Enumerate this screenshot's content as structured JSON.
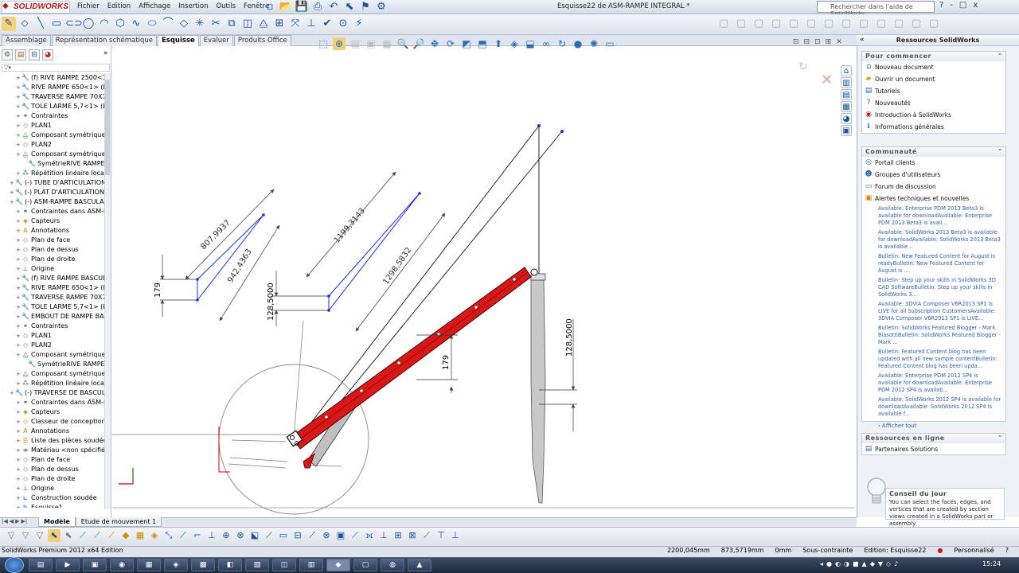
{
  "app": {
    "logo_text": "SOLIDWORKS",
    "window_title": "Esquisse22 de ASM-RAMPE INTEGRAL *",
    "menu": [
      "Fichier",
      "Edition",
      "Affichage",
      "Insertion",
      "Outils",
      "Fenêtre"
    ],
    "help_search_placeholder": "Rechercher dans l'aide de SolidWorks",
    "window_controls": [
      "?",
      "-",
      "□",
      "x"
    ]
  },
  "command_tabs": [
    "Assemblage",
    "Représentation schématique",
    "Esquisse",
    "Evaluer",
    "Produits Office"
  ],
  "active_command_tab": "Esquisse",
  "feature_tree": [
    {
      "label": "(f) RIVE RAMPE 2500<1> (",
      "indent": 2,
      "icon": "part"
    },
    {
      "label": "RIVE RAMPE 650<1> (Déf",
      "indent": 2,
      "icon": "part"
    },
    {
      "label": "TRAVERSE RAMPE 70X70",
      "indent": 2,
      "icon": "part"
    },
    {
      "label": "TOLE LARME 5,7<1> (Déf",
      "indent": 2,
      "icon": "part"
    },
    {
      "label": "Contraintes",
      "indent": 2,
      "icon": "mates"
    },
    {
      "label": "PLAN1",
      "indent": 2,
      "icon": "plane"
    },
    {
      "label": "Composant symétrique1",
      "indent": 2,
      "icon": "mirror"
    },
    {
      "label": "PLAN2",
      "indent": 2,
      "icon": "plane"
    },
    {
      "label": "Composant symétrique2",
      "indent": 2,
      "icon": "mirror"
    },
    {
      "label": "SymétrieRIVE RAMPE",
      "indent": 3,
      "icon": "part"
    },
    {
      "label": "Répétition linéaire locale1",
      "indent": 2,
      "icon": "pattern"
    },
    {
      "label": "(-) TUBE D'ARTICULATION D",
      "indent": 1,
      "icon": "part"
    },
    {
      "label": "(-) PLAT D'ARTICULATION T",
      "indent": 1,
      "icon": "part"
    },
    {
      "label": "(-) ASM-RAMPE BASCULANT",
      "indent": 1,
      "icon": "asm"
    },
    {
      "label": "Contraintes dans ASM-RA",
      "indent": 2,
      "icon": "mates"
    },
    {
      "label": "Capteurs",
      "indent": 2,
      "icon": "sensor"
    },
    {
      "label": "Annotations",
      "indent": 2,
      "icon": "annot"
    },
    {
      "label": "Plan de face",
      "indent": 2,
      "icon": "plane"
    },
    {
      "label": "Plan de dessus",
      "indent": 2,
      "icon": "plane"
    },
    {
      "label": "Plan de droite",
      "indent": 2,
      "icon": "plane"
    },
    {
      "label": "Origine",
      "indent": 2,
      "icon": "origin"
    },
    {
      "label": "(f) RIVE RAMPE BASCULA",
      "indent": 2,
      "icon": "part"
    },
    {
      "label": "RIVE RAMPE 650<1> (Déf",
      "indent": 2,
      "icon": "part"
    },
    {
      "label": "TRAVERSE RAMPE 70X70",
      "indent": 2,
      "icon": "part"
    },
    {
      "label": "TOLE LARME 5,7<1> (Déf",
      "indent": 2,
      "icon": "part"
    },
    {
      "label": "EMBOUT DE RAMPE BASC",
      "indent": 2,
      "icon": "part"
    },
    {
      "label": "Contraintes",
      "indent": 2,
      "icon": "mates"
    },
    {
      "label": "PLAN1",
      "indent": 2,
      "icon": "plane"
    },
    {
      "label": "PLAN2",
      "indent": 2,
      "icon": "plane"
    },
    {
      "label": "Composant symétrique1",
      "indent": 2,
      "icon": "mirror"
    },
    {
      "label": "SymétrieRIVE RAMPE",
      "indent": 3,
      "icon": "part"
    },
    {
      "label": "Composant symétrique2",
      "indent": 2,
      "icon": "mirror"
    },
    {
      "label": "Répétition linéaire locale1",
      "indent": 2,
      "icon": "pattern"
    },
    {
      "label": "(-) TRAVERSE DE BASCULEM",
      "indent": 1,
      "icon": "part"
    },
    {
      "label": "Contraintes dans ASM-RA",
      "indent": 2,
      "icon": "mates"
    },
    {
      "label": "Capteurs",
      "indent": 2,
      "icon": "sensor"
    },
    {
      "label": "Classeur de conception",
      "indent": 2,
      "icon": "folder"
    },
    {
      "label": "Annotations",
      "indent": 2,
      "icon": "annot"
    },
    {
      "label": "Liste des pièces soudées(1",
      "indent": 2,
      "icon": "list"
    },
    {
      "label": "Matériau <non spécifié>",
      "indent": 2,
      "icon": "material"
    },
    {
      "label": "Plan de face",
      "indent": 2,
      "icon": "plane"
    },
    {
      "label": "Plan de dessus",
      "indent": 2,
      "icon": "plane"
    },
    {
      "label": "Plan de droite",
      "indent": 2,
      "icon": "plane"
    },
    {
      "label": "Origine",
      "indent": 2,
      "icon": "origin"
    },
    {
      "label": "Construction soudée",
      "indent": 2,
      "icon": "weld"
    },
    {
      "label": "Esquisse1",
      "indent": 2,
      "icon": "sketch"
    }
  ],
  "dimensions": {
    "d1": "807,9937",
    "d2": "942,4363",
    "d3": "1199,3143",
    "d4": "1298,5832",
    "d5": "179",
    "d6": "128,5000",
    "d7": "179",
    "d8": "128,5000"
  },
  "colors": {
    "ramp": "#d81818",
    "sketch_blue": "#1a2fd8",
    "dim_grey": "#555555",
    "selected_line": "#0000ff"
  },
  "taskpane": {
    "title": "Ressources SolidWorks",
    "sections": [
      {
        "title": "Pour commencer",
        "links": [
          {
            "label": "Nouveau document",
            "icon": "new-doc-icon"
          },
          {
            "label": "Ouvrir un document",
            "icon": "open-folder-icon"
          },
          {
            "label": "Tutoriels",
            "icon": "tutorial-icon"
          },
          {
            "label": "Nouveautés",
            "icon": "whats-new-icon"
          },
          {
            "label": "Introduction à SolidWorks",
            "icon": "intro-icon"
          },
          {
            "label": "Informations générales",
            "icon": "info-icon"
          }
        ]
      },
      {
        "title": "Communauté",
        "links": [
          {
            "label": "Portail clients",
            "icon": "portal-icon"
          },
          {
            "label": "Groupes d'utilisateurs",
            "icon": "users-icon"
          },
          {
            "label": "Forum de discussion",
            "icon": "forum-icon"
          },
          {
            "label": "Alertes techniques et nouvelles",
            "icon": "rss-icon"
          }
        ],
        "news": [
          "Available: Enterprise PDM 2013 Beta3 is available for downloadAvailable: Enterprise PDM 2013 Beta3 is avail...",
          "Available: SolidWorks 2013 Beta3 is available for downloadAvailable: SolidWorks 2013 Beta3 is available...",
          "Bulletin: New Featured Content for August is readyBulletin: New Featured Content for August is ...",
          "Bulletin: Step up your skills in SolidWorks 3D CAD SoftwareBulletin: Step up your skills in SolidWorks 3...",
          "Available: 3DVIA Composer V6R2013 SP1 is LIVE for all Subscription CustomersAvailable: 3DVIA Composer V6R2013 SP1 is LIVE...",
          "Bulletin: SolidWorks Featured Blogger - Mark BiasottiBulletin: SolidWorks Featured Blogger - Mark ...",
          "Bulletin: Featured Content blog has been updated with all new sample contentBulletin: Featured Content blog has been upda...",
          "Available: Enterprise PDM 2012 SP4 is available for downloadAvailable: Enterprise PDM 2012 SP4 is availab...",
          "Available: SolidWorks 2012 SP4 is available for downloadAvailable: SolidWorks 2012 SP4 is available f..."
        ],
        "more": "Afficher tout"
      },
      {
        "title": "Ressources en ligne",
        "links": [
          {
            "label": "Partenaires Solutions",
            "icon": "partners-icon"
          }
        ]
      }
    ],
    "tip": {
      "title": "Conseil du jour",
      "text": "You can select the faces, edges, and vertices that are created by section views created in a SolidWorks part or assembly."
    }
  },
  "bottom_tabs": [
    "Modèle",
    "Etude de mouvement 1"
  ],
  "active_bottom_tab": "Modèle",
  "status": {
    "left": "SolidWorks Premium 2012 x64 Edition",
    "x": "2200,045mm",
    "y": "873,5719mm",
    "z": "0mm",
    "state": "Sous-contrainte",
    "edition": "Edition: Esquisse22",
    "units": "Personnalisé"
  },
  "clock": "15:24"
}
